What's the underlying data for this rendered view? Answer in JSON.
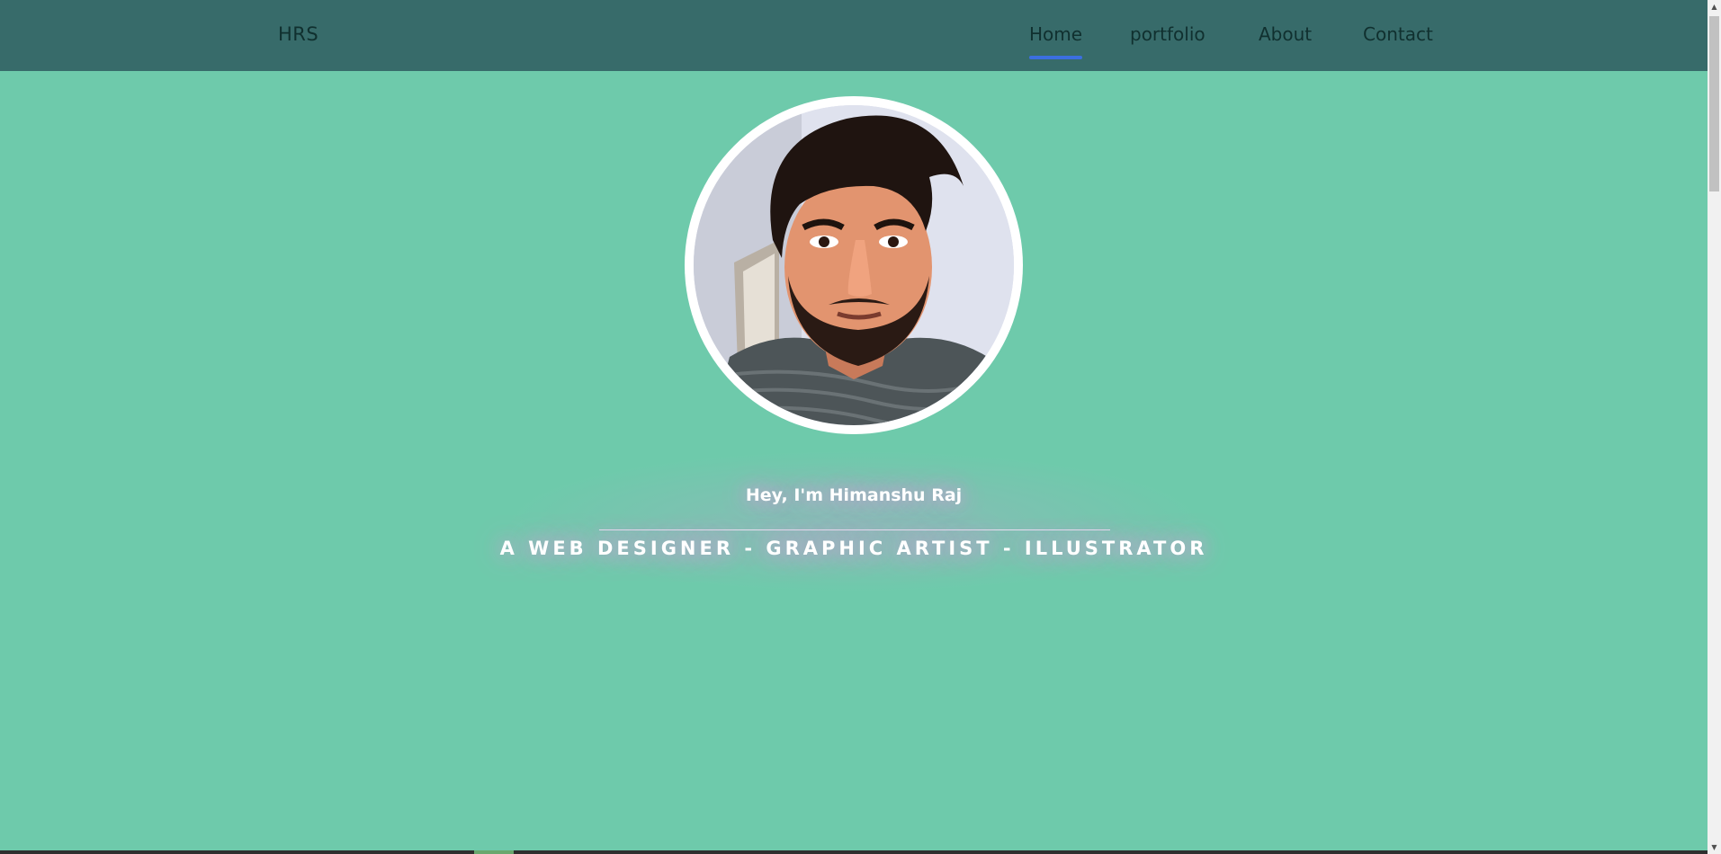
{
  "header": {
    "brand": "HRS",
    "nav": [
      {
        "label": "Home",
        "active": true
      },
      {
        "label": "portfolio",
        "active": false
      },
      {
        "label": "About",
        "active": false
      },
      {
        "label": "Contact",
        "active": false
      }
    ]
  },
  "hero": {
    "greeting": "Hey, I'm Himanshu Raj",
    "tagline": "A WEB DESIGNER - GRAPHIC ARTIST - ILLUSTRATOR"
  },
  "colors": {
    "background": "#6ecaab",
    "navbar": "#376b6a",
    "nav_text": "#10302f",
    "active_underline": "#3b6fe0",
    "text_glow": "#d59ad8"
  }
}
